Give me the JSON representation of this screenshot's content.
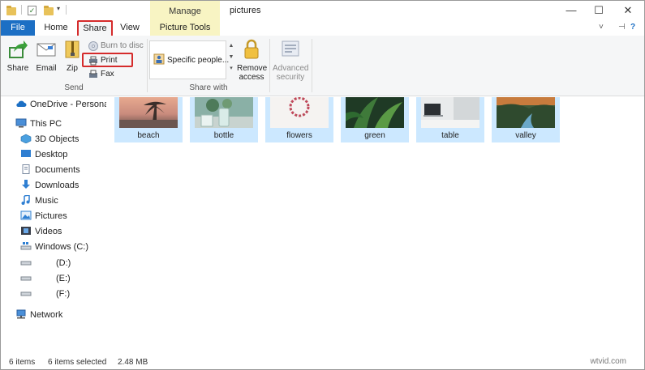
{
  "window": {
    "title": "pictures",
    "context_tab_group": "Manage",
    "controls": {
      "minimize": "—",
      "maximize": "☐",
      "close": "✕"
    }
  },
  "tabs": [
    {
      "label": "File"
    },
    {
      "label": "Home"
    },
    {
      "label": "Share"
    },
    {
      "label": "View"
    },
    {
      "label": "Picture Tools"
    }
  ],
  "ribbon_extras": {
    "pin": "⊣",
    "help": "?",
    "collapse": "˅"
  },
  "ribbon": {
    "send_group": {
      "label": "Send",
      "share": "Share",
      "email": "Email",
      "zip": "Zip",
      "burn": "Burn to disc",
      "print": "Print",
      "fax": "Fax"
    },
    "share_with_group": {
      "label": "Share with",
      "gallery_item": "Specific people...",
      "remove_access_line1": "Remove",
      "remove_access_line2": "access"
    },
    "advanced_security": {
      "line1": "Advanced",
      "line2": "security"
    }
  },
  "nav": {
    "onedrive": "OneDrive - Personal",
    "thispc": "This PC",
    "items": [
      {
        "label": "3D Objects"
      },
      {
        "label": "Desktop"
      },
      {
        "label": "Documents"
      },
      {
        "label": "Downloads"
      },
      {
        "label": "Music"
      },
      {
        "label": "Pictures"
      },
      {
        "label": "Videos"
      },
      {
        "label": "Windows (C:)"
      },
      {
        "label": "(D:)"
      },
      {
        "label": "(E:)"
      },
      {
        "label": "(F:)"
      }
    ],
    "network": "Network"
  },
  "files": [
    {
      "name": "beach"
    },
    {
      "name": "bottle"
    },
    {
      "name": "flowers"
    },
    {
      "name": "green"
    },
    {
      "name": "table"
    },
    {
      "name": "valley"
    }
  ],
  "status": {
    "count": "6 items",
    "selected": "6 items selected",
    "size": "2.48 MB",
    "watermark": "wtvid.com"
  },
  "colors": {
    "file_tab": "#1c6fc4",
    "context_tab": "#f8f4c3",
    "selection": "#cce8ff",
    "highlight": "#d52b2b"
  }
}
